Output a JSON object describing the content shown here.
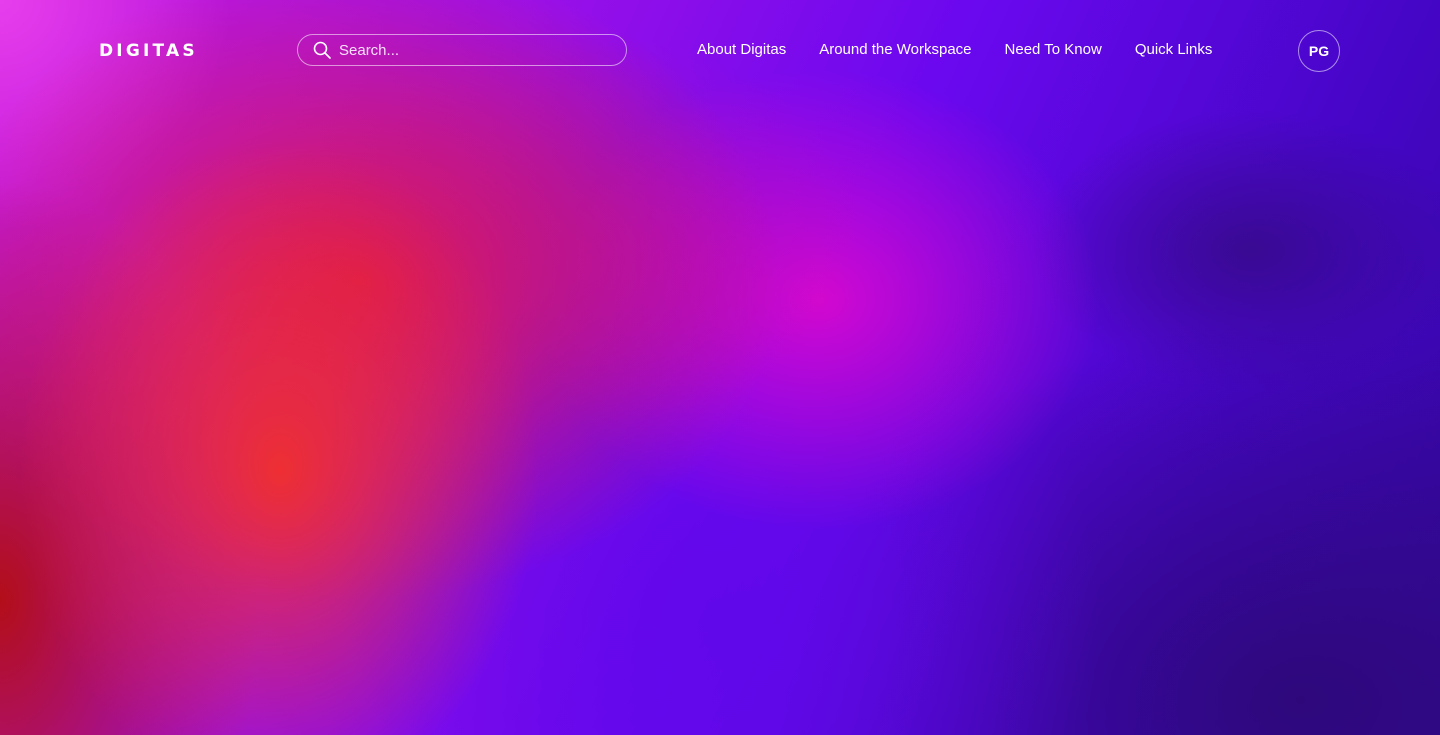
{
  "header": {
    "logo": "DIGITAS",
    "search": {
      "icon": "search-icon",
      "placeholder": "Search...",
      "value": ""
    },
    "nav": [
      {
        "label": "About Digitas"
      },
      {
        "label": "Around the Workspace"
      },
      {
        "label": "Need To Know"
      },
      {
        "label": "Quick Links"
      }
    ],
    "avatar_initials": "PG"
  },
  "colors": {
    "text": "#ffffff",
    "gradient": [
      "#e840ee",
      "#e41c40",
      "#f1302c",
      "#d808ce",
      "#6008ea",
      "#2d0878"
    ]
  }
}
